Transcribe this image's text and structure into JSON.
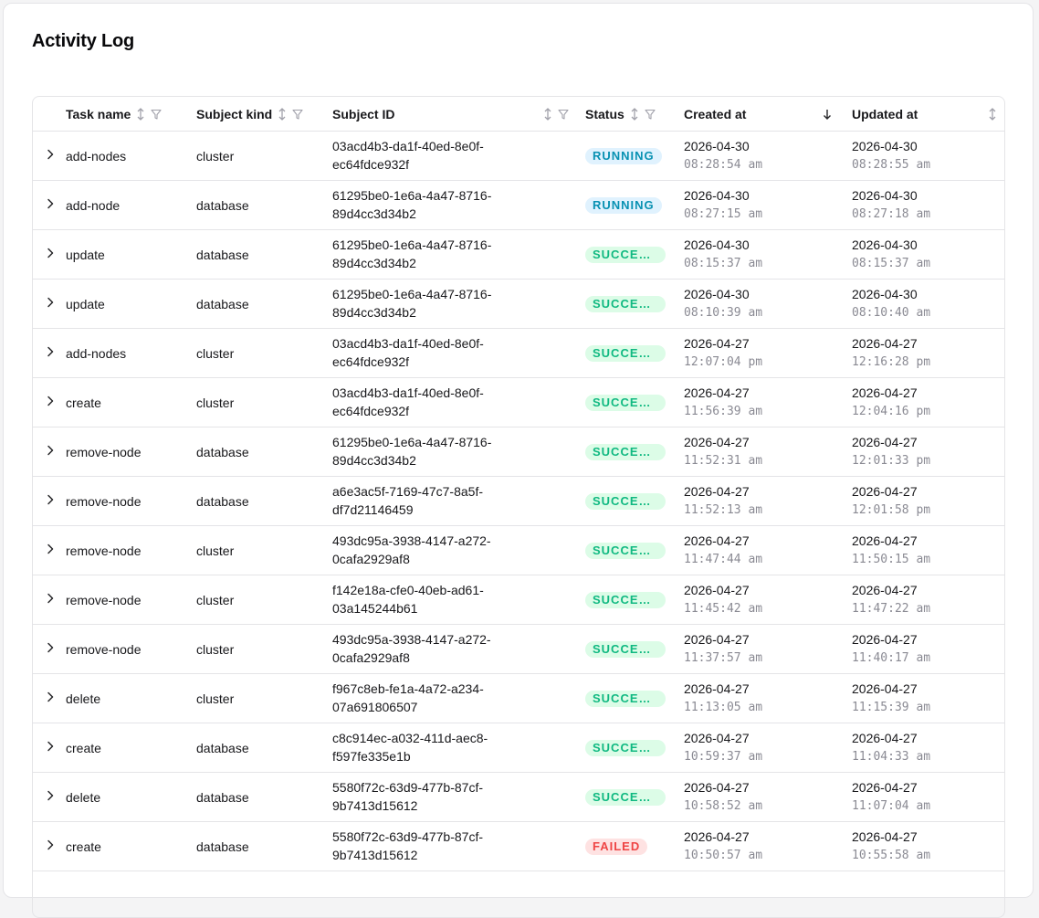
{
  "page": {
    "title": "Activity Log"
  },
  "table": {
    "columns": {
      "task_name": "Task name",
      "subject_kind": "Subject kind",
      "subject_id": "Subject ID",
      "status": "Status",
      "created_at": "Created at",
      "updated_at": "Updated at"
    },
    "sort": {
      "column": "Created at",
      "direction": "descending"
    },
    "rows": [
      {
        "task": "add-nodes",
        "kind": "cluster",
        "sid1": "03acd4b3-da1f-40ed-8e0f-",
        "sid2": "ec64fdce932f",
        "status": "RUNNING",
        "status_type": "running",
        "created_date": "2026-04-30",
        "created_time": "08:28:54 am",
        "updated_date": "2026-04-30",
        "updated_time": "08:28:55 am"
      },
      {
        "task": "add-node",
        "kind": "database",
        "sid1": "61295be0-1e6a-4a47-8716-",
        "sid2": "89d4cc3d34b2",
        "status": "RUNNING",
        "status_type": "running",
        "created_date": "2026-04-30",
        "created_time": "08:27:15 am",
        "updated_date": "2026-04-30",
        "updated_time": "08:27:18 am"
      },
      {
        "task": "update",
        "kind": "database",
        "sid1": "61295be0-1e6a-4a47-8716-",
        "sid2": "89d4cc3d34b2",
        "status": "SUCCEEDED",
        "status_type": "succeeded",
        "created_date": "2026-04-30",
        "created_time": "08:15:37 am",
        "updated_date": "2026-04-30",
        "updated_time": "08:15:37 am"
      },
      {
        "task": "update",
        "kind": "database",
        "sid1": "61295be0-1e6a-4a47-8716-",
        "sid2": "89d4cc3d34b2",
        "status": "SUCCEEDED",
        "status_type": "succeeded",
        "created_date": "2026-04-30",
        "created_time": "08:10:39 am",
        "updated_date": "2026-04-30",
        "updated_time": "08:10:40 am"
      },
      {
        "task": "add-nodes",
        "kind": "cluster",
        "sid1": "03acd4b3-da1f-40ed-8e0f-",
        "sid2": "ec64fdce932f",
        "status": "SUCCEEDED",
        "status_type": "succeeded",
        "created_date": "2026-04-27",
        "created_time": "12:07:04 pm",
        "updated_date": "2026-04-27",
        "updated_time": "12:16:28 pm"
      },
      {
        "task": "create",
        "kind": "cluster",
        "sid1": "03acd4b3-da1f-40ed-8e0f-",
        "sid2": "ec64fdce932f",
        "status": "SUCCEEDED",
        "status_type": "succeeded",
        "created_date": "2026-04-27",
        "created_time": "11:56:39 am",
        "updated_date": "2026-04-27",
        "updated_time": "12:04:16 pm"
      },
      {
        "task": "remove-node",
        "kind": "database",
        "sid1": "61295be0-1e6a-4a47-8716-",
        "sid2": "89d4cc3d34b2",
        "status": "SUCCEEDED",
        "status_type": "succeeded",
        "created_date": "2026-04-27",
        "created_time": "11:52:31 am",
        "updated_date": "2026-04-27",
        "updated_time": "12:01:33 pm"
      },
      {
        "task": "remove-node",
        "kind": "database",
        "sid1": "a6e3ac5f-7169-47c7-8a5f-",
        "sid2": "df7d21146459",
        "status": "SUCCEEDED",
        "status_type": "succeeded",
        "created_date": "2026-04-27",
        "created_time": "11:52:13 am",
        "updated_date": "2026-04-27",
        "updated_time": "12:01:58 pm"
      },
      {
        "task": "remove-node",
        "kind": "cluster",
        "sid1": "493dc95a-3938-4147-a272-",
        "sid2": "0cafa2929af8",
        "status": "SUCCEEDED",
        "status_type": "succeeded",
        "created_date": "2026-04-27",
        "created_time": "11:47:44 am",
        "updated_date": "2026-04-27",
        "updated_time": "11:50:15 am"
      },
      {
        "task": "remove-node",
        "kind": "cluster",
        "sid1": "f142e18a-cfe0-40eb-ad61-",
        "sid2": "03a145244b61",
        "status": "SUCCEEDED",
        "status_type": "succeeded",
        "created_date": "2026-04-27",
        "created_time": "11:45:42 am",
        "updated_date": "2026-04-27",
        "updated_time": "11:47:22 am"
      },
      {
        "task": "remove-node",
        "kind": "cluster",
        "sid1": "493dc95a-3938-4147-a272-",
        "sid2": "0cafa2929af8",
        "status": "SUCCEEDED",
        "status_type": "succeeded",
        "created_date": "2026-04-27",
        "created_time": "11:37:57 am",
        "updated_date": "2026-04-27",
        "updated_time": "11:40:17 am"
      },
      {
        "task": "delete",
        "kind": "cluster",
        "sid1": "f967c8eb-fe1a-4a72-a234-",
        "sid2": "07a691806507",
        "status": "SUCCEEDED",
        "status_type": "succeeded",
        "created_date": "2026-04-27",
        "created_time": "11:13:05 am",
        "updated_date": "2026-04-27",
        "updated_time": "11:15:39 am"
      },
      {
        "task": "create",
        "kind": "database",
        "sid1": "c8c914ec-a032-411d-aec8-",
        "sid2": "f597fe335e1b",
        "status": "SUCCEEDED",
        "status_type": "succeeded",
        "created_date": "2026-04-27",
        "created_time": "10:59:37 am",
        "updated_date": "2026-04-27",
        "updated_time": "11:04:33 am"
      },
      {
        "task": "delete",
        "kind": "database",
        "sid1": "5580f72c-63d9-477b-87cf-",
        "sid2": "9b7413d15612",
        "status": "SUCCEEDED",
        "status_type": "succeeded",
        "created_date": "2026-04-27",
        "created_time": "10:58:52 am",
        "updated_date": "2026-04-27",
        "updated_time": "11:07:04 am"
      },
      {
        "task": "create",
        "kind": "database",
        "sid1": "5580f72c-63d9-477b-87cf-",
        "sid2": "9b7413d15612",
        "status": "FAILED",
        "status_type": "failed",
        "created_date": "2026-04-27",
        "created_time": "10:50:57 am",
        "updated_date": "2026-04-27",
        "updated_time": "10:55:58 am"
      }
    ]
  },
  "icons": {
    "expand": "chevron-right-icon",
    "sort": "sort-arrows-icon",
    "sort_active": "arrow-down-icon",
    "filter": "filter-icon"
  },
  "colors": {
    "running_bg": "#e0f2fe",
    "running_fg": "#0891b2",
    "succeeded_bg": "#dcfce7",
    "succeeded_fg": "#10b981",
    "failed_bg": "#fee2e2",
    "failed_fg": "#ef4444"
  }
}
